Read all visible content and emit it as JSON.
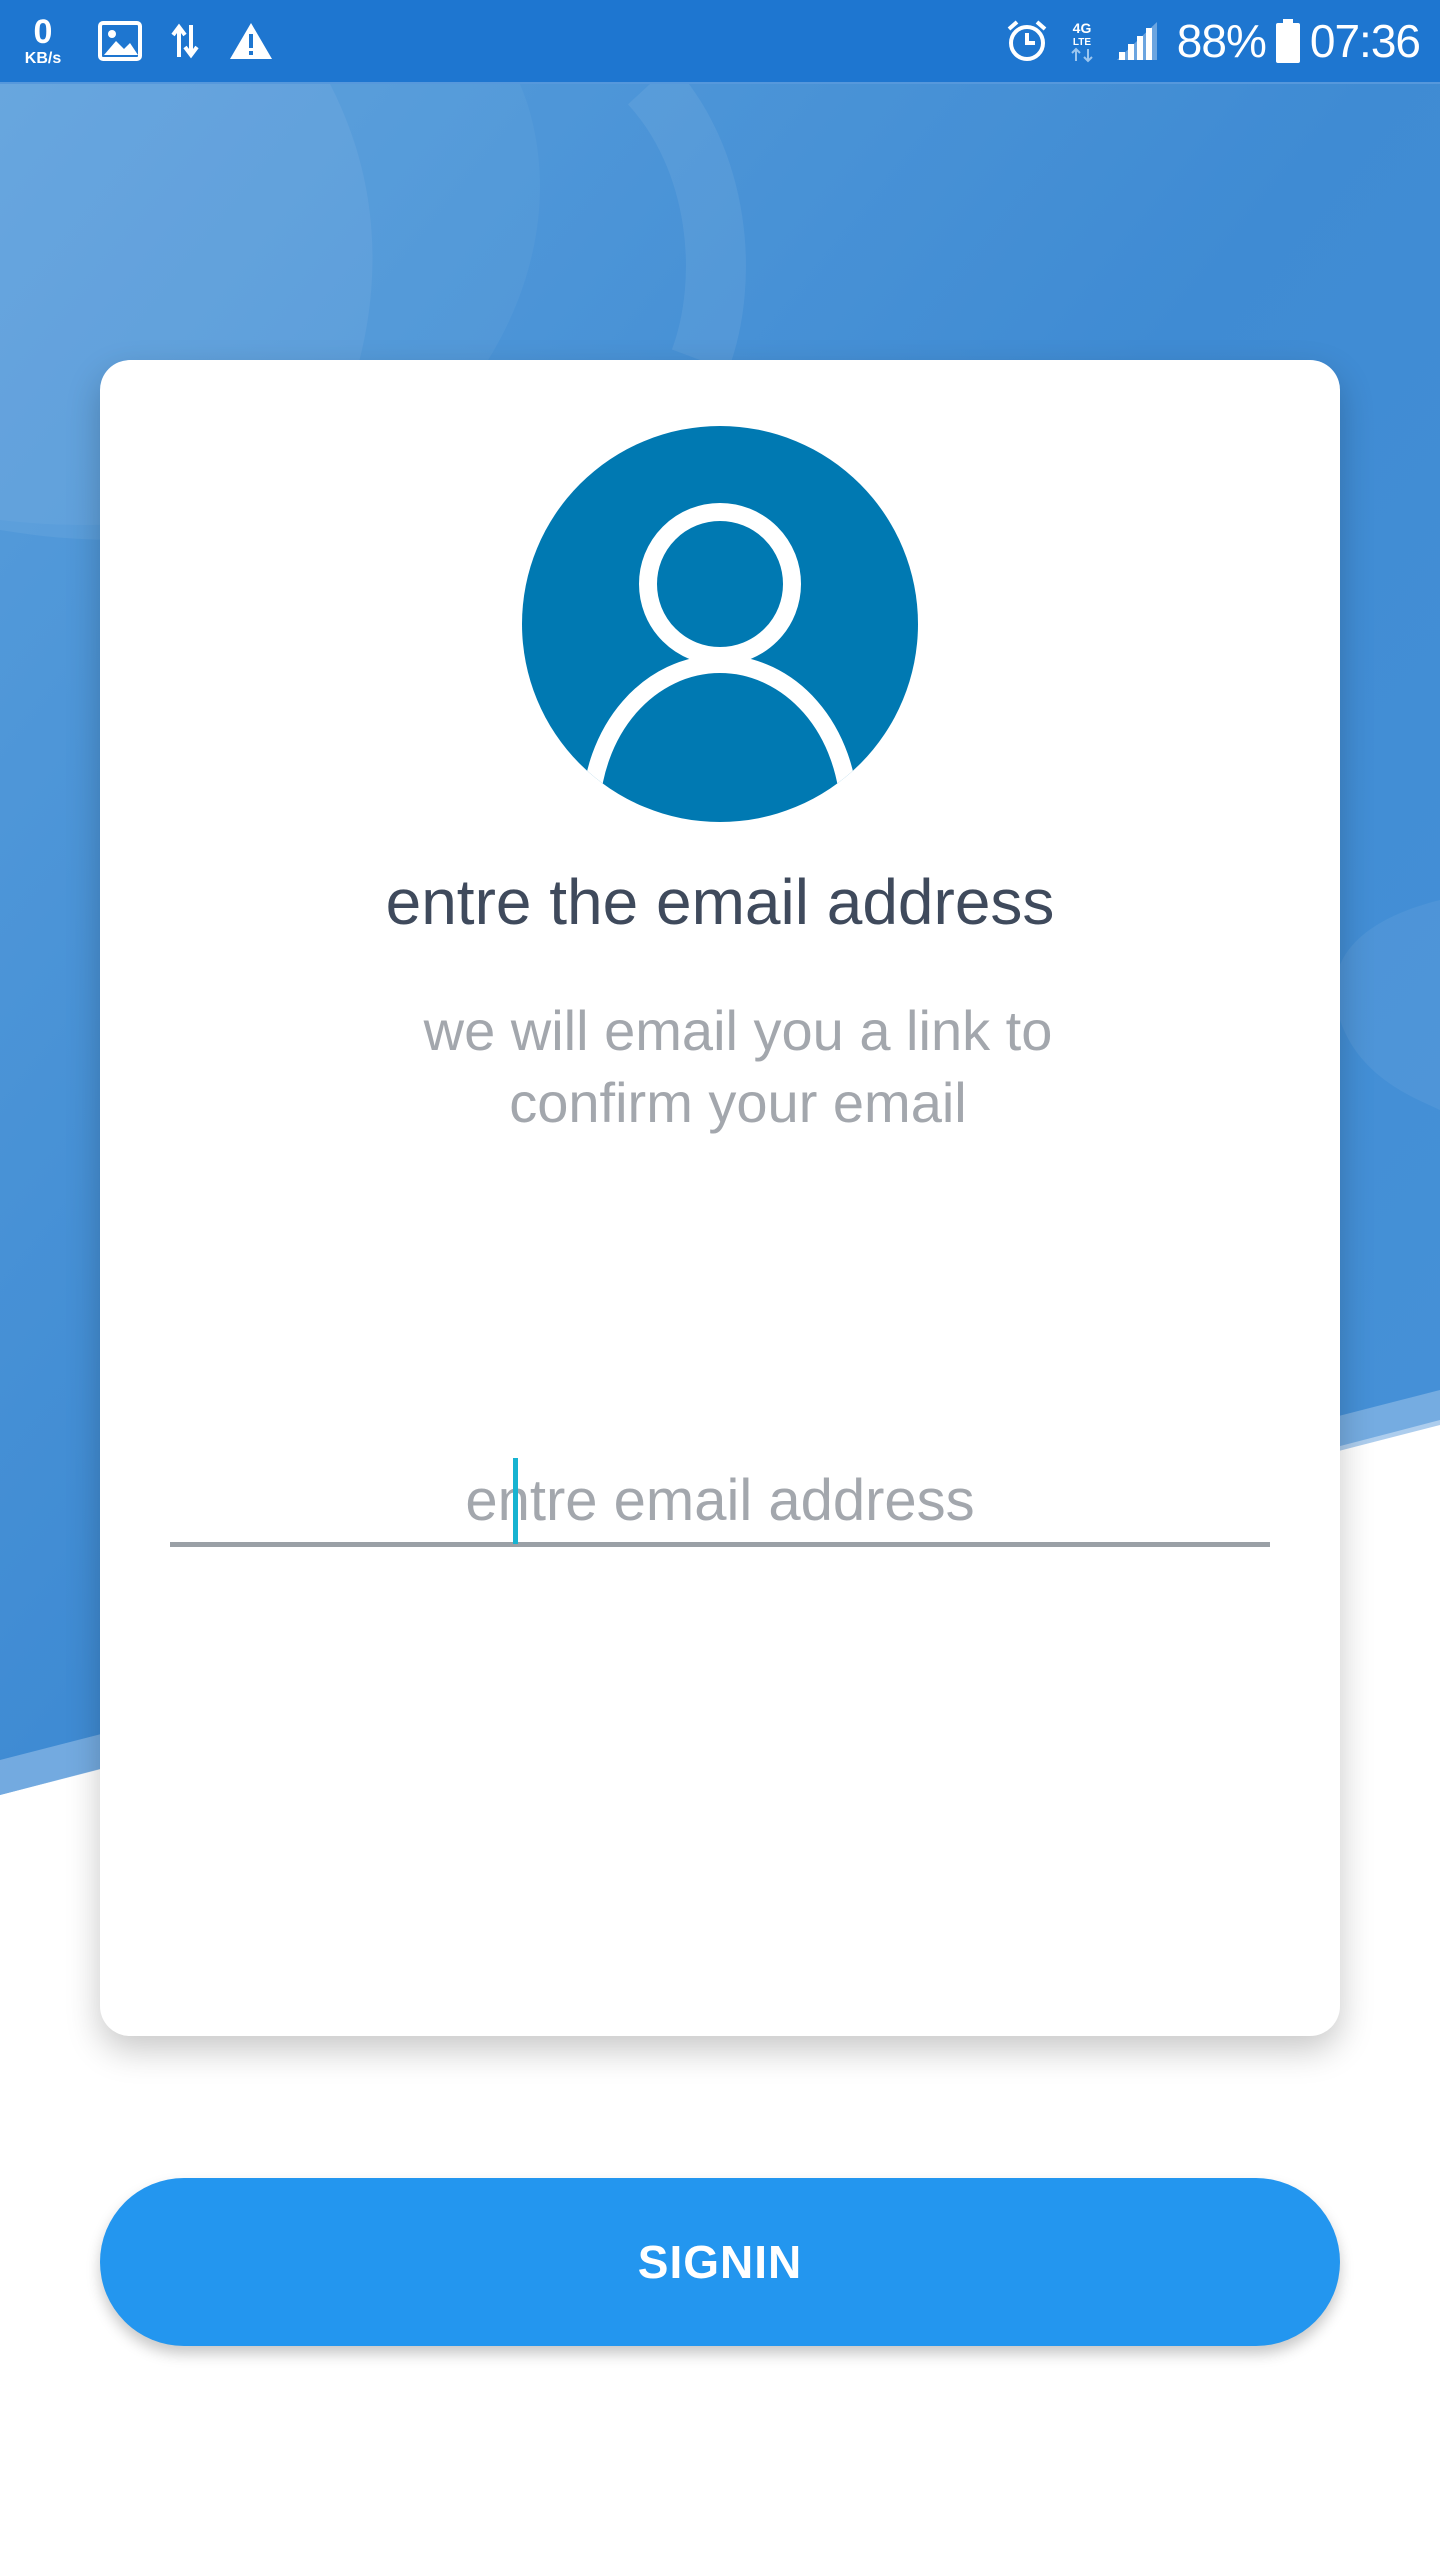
{
  "status_bar": {
    "net_speed_value": "0",
    "net_speed_unit": "KB/s",
    "battery_percent": "88%",
    "time": "07:36",
    "left_icons": [
      "image-icon",
      "data-transfer-icon",
      "warning-icon"
    ],
    "right_icons": [
      "alarm-icon",
      "4g-lte-icon",
      "signal-icon",
      "battery-icon"
    ]
  },
  "card": {
    "avatar_icon": "user-avatar-icon",
    "title": "entre the email address",
    "subtitle": "we will email you a link to confirm your email",
    "email_field": {
      "value": "",
      "placeholder": "entre email address"
    }
  },
  "signin_button": {
    "label": "SIGNIN"
  },
  "colors": {
    "status_bar": "#1e76d0",
    "background_blue": "#4a90d9",
    "avatar": "#0079b2",
    "title_text": "#3f4a5c",
    "subtitle_text": "#a3a7ad",
    "caret": "#17b3d1",
    "button": "#2396ef"
  }
}
